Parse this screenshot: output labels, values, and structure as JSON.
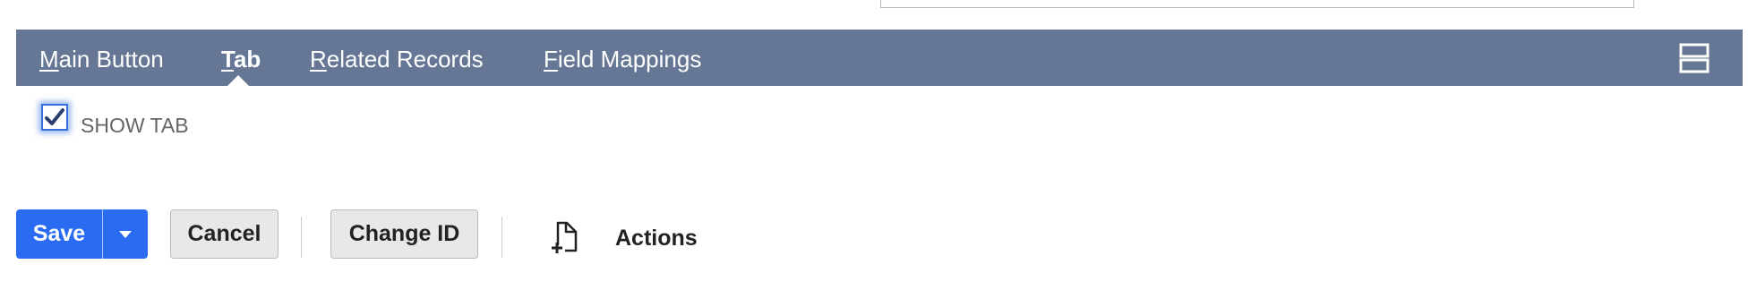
{
  "tabs": [
    {
      "first": "M",
      "rest": "ain Button"
    },
    {
      "first": "T",
      "rest": "ab"
    },
    {
      "first": "R",
      "rest": "elated Records"
    },
    {
      "first": "F",
      "rest": "ield Mappings"
    }
  ],
  "active_tab": "Tab",
  "layout_toggle_icon": "stacked-layout-icon",
  "show_tab": {
    "checked": true,
    "label": "SHOW TAB"
  },
  "buttons": {
    "save": "Save",
    "cancel": "Cancel",
    "change_id": "Change ID",
    "actions": "Actions"
  },
  "icons": {
    "save_dropdown": "caret-down-icon",
    "actions": "new-document-icon"
  },
  "colors": {
    "tab_bar": "#657795",
    "primary": "#2b6bf2",
    "checkbox_accent": "#3a6fd8"
  }
}
